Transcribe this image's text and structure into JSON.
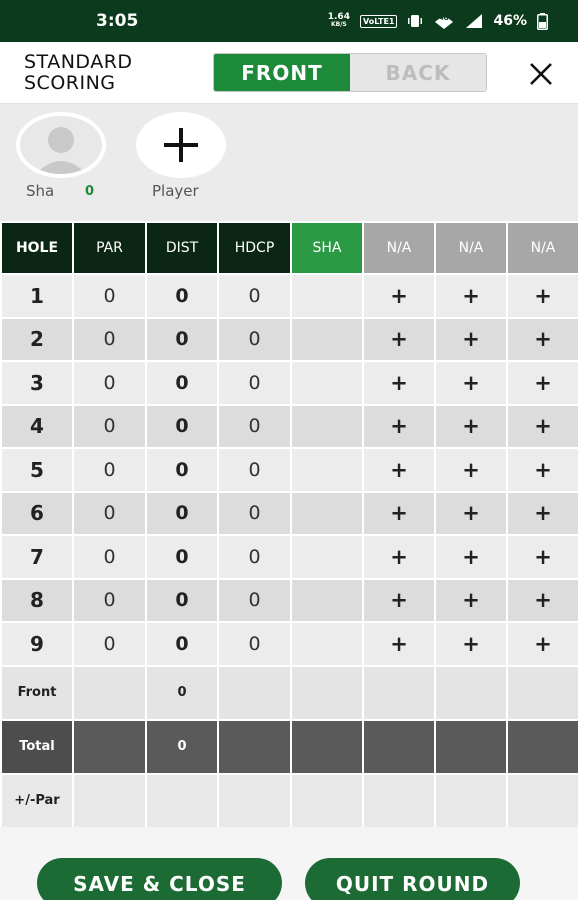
{
  "status_bar": {
    "time": "3:05",
    "net_speed": "1.64",
    "net_unit": "KB/S",
    "volte": "VoLTE1",
    "network": "4G",
    "battery": "46%"
  },
  "header": {
    "title_line1": "STANDARD",
    "title_line2": "SCORING",
    "toggle_front": "FRONT",
    "toggle_back": "BACK",
    "active_tab": "FRONT"
  },
  "players": {
    "current": {
      "name": "Sha",
      "score": "0"
    },
    "add_label": "Player"
  },
  "table": {
    "headers": [
      "HOLE",
      "PAR",
      "DIST",
      "HDCP",
      "SHA",
      "N/A",
      "N/A",
      "N/A"
    ],
    "rows": [
      {
        "hole": "1",
        "par": "0",
        "dist": "0",
        "hdcp": "0"
      },
      {
        "hole": "2",
        "par": "0",
        "dist": "0",
        "hdcp": "0"
      },
      {
        "hole": "3",
        "par": "0",
        "dist": "0",
        "hdcp": "0"
      },
      {
        "hole": "4",
        "par": "0",
        "dist": "0",
        "hdcp": "0"
      },
      {
        "hole": "5",
        "par": "0",
        "dist": "0",
        "hdcp": "0"
      },
      {
        "hole": "6",
        "par": "0",
        "dist": "0",
        "hdcp": "0"
      },
      {
        "hole": "7",
        "par": "0",
        "dist": "0",
        "hdcp": "0"
      },
      {
        "hole": "8",
        "par": "0",
        "dist": "0",
        "hdcp": "0"
      },
      {
        "hole": "9",
        "par": "0",
        "dist": "0",
        "hdcp": "0"
      }
    ],
    "add_symbol": "+",
    "front_label": "Front",
    "front_dist": "0",
    "total_label": "Total",
    "total_dist": "0",
    "plusminus_label": "+/-Par"
  },
  "buttons": {
    "save_close": "SAVE & CLOSE",
    "quit_round": "QUIT ROUND"
  },
  "colors": {
    "status_bar": "#0b3b1c",
    "active_green": "#1d8a3a",
    "header_dark": "#0b2614",
    "player_col_green": "#2a9a44",
    "na_gray": "#a7a7a7",
    "button_green": "#1d6b34"
  }
}
